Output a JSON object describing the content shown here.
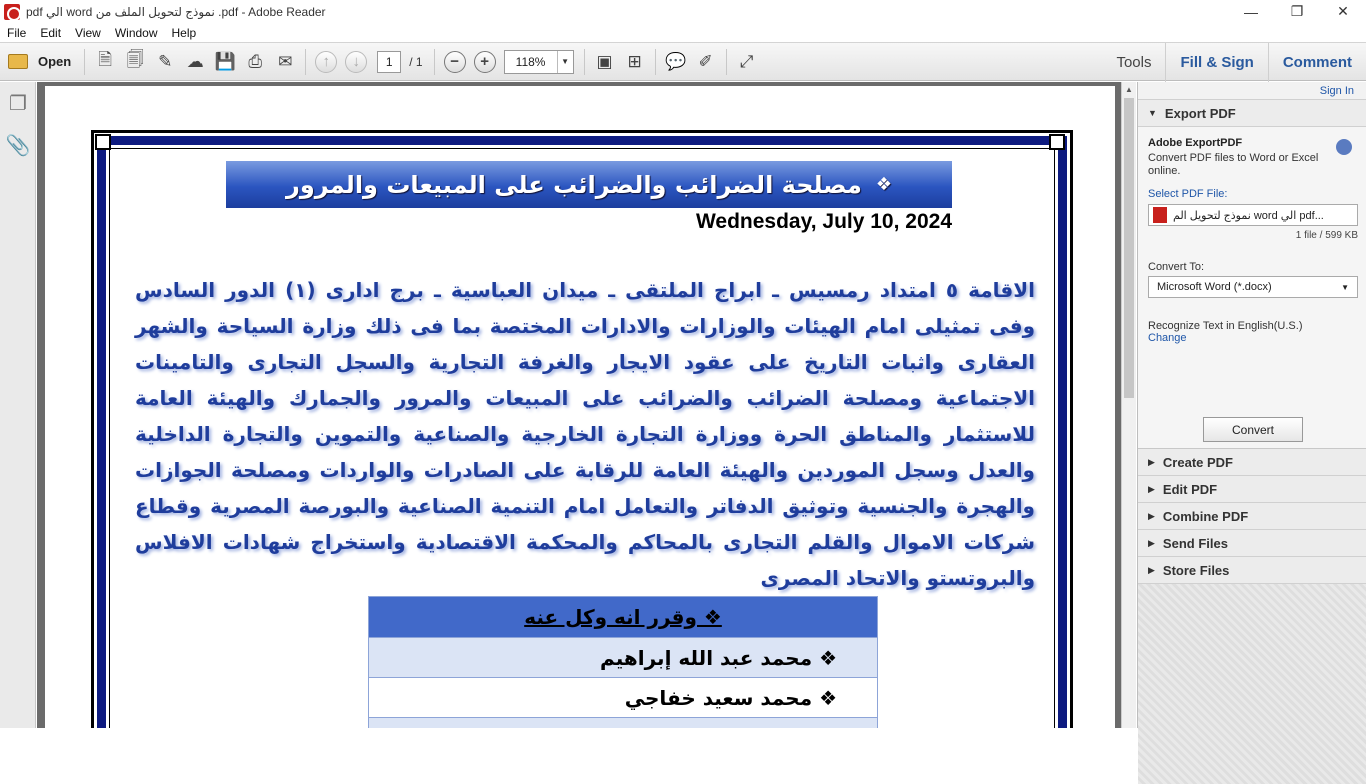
{
  "window": {
    "title": "pdf الي word نموذج لتحويل الملف من .pdf - Adobe Reader",
    "controls": {
      "minimize": "—",
      "restore": "❐",
      "close": "✕"
    }
  },
  "menu": [
    "File",
    "Edit",
    "View",
    "Window",
    "Help"
  ],
  "toolbar": {
    "open_label": "Open",
    "page_current": "1",
    "page_total": "/ 1",
    "zoom": "118%",
    "tabs": {
      "tools": "Tools",
      "fill_sign": "Fill & Sign",
      "comment": "Comment"
    }
  },
  "document": {
    "header": "مصلحة الضرائب والضرائب على المبيعات والمرور",
    "header_bullet": "❖",
    "date": "Wednesday, July 10, 2024",
    "paragraph": "الاقامة ٥ امتداد رمسيس ـ ابراج الملتقى ـ ميدان العباسية ـ برج ادارى (١) الدور السادس وفى تمثيلى امام الهيئات والوزارات والادارات المختصة بما فى ذلك وزارة السياحة والشهر العقارى واثبات التاريخ على عقود الايجار والغرفة التجارية والسجل التجارى والتامينات الاجتماعية ومصلحة الضرائب والضرائب على المبيعات والمرور والجمارك والهيئة العامة للاستثمار والمناطق الحرة ووزارة التجارة الخارجية والصناعية والتموين والتجارة الداخلية والعدل وسجل الموردين والهيئة العامة للرقابة على الصادرات والواردات ومصلحة الجوازات والهجرة والجنسية وتوثيق الدفاتر والتعامل امام التنمية الصناعية والبورصة المصرية وقطاع شركات الاموال والقلم التجارى بالمحاكم والمحكمة الاقتصادية واستخراج شهادات الافلاس والبروتستو والاتحاد المصرى",
    "table_header": "❖ وقرر انه وكل عنه",
    "table_rows": [
      "❖ محمد عبد الله إبراهيم",
      "❖ محمد سعيد خفاجي"
    ]
  },
  "side_panel": {
    "sign_in": "Sign In",
    "export_title": "Export PDF",
    "adobe_export": "Adobe ExportPDF",
    "description": "Convert PDF files to Word or Excel online.",
    "select_label": "Select PDF File:",
    "file_name": "نموذج لتحويل الم word الي pdf...",
    "file_size": "1 file / 599 KB",
    "convert_to_label": "Convert To:",
    "convert_to_value": "Microsoft Word (*.docx)",
    "recognize": "Recognize Text in English(U.S.)",
    "change": "Change",
    "convert_button": "Convert",
    "sections": [
      "Create PDF",
      "Edit PDF",
      "Combine PDF",
      "Send Files",
      "Store Files"
    ]
  }
}
